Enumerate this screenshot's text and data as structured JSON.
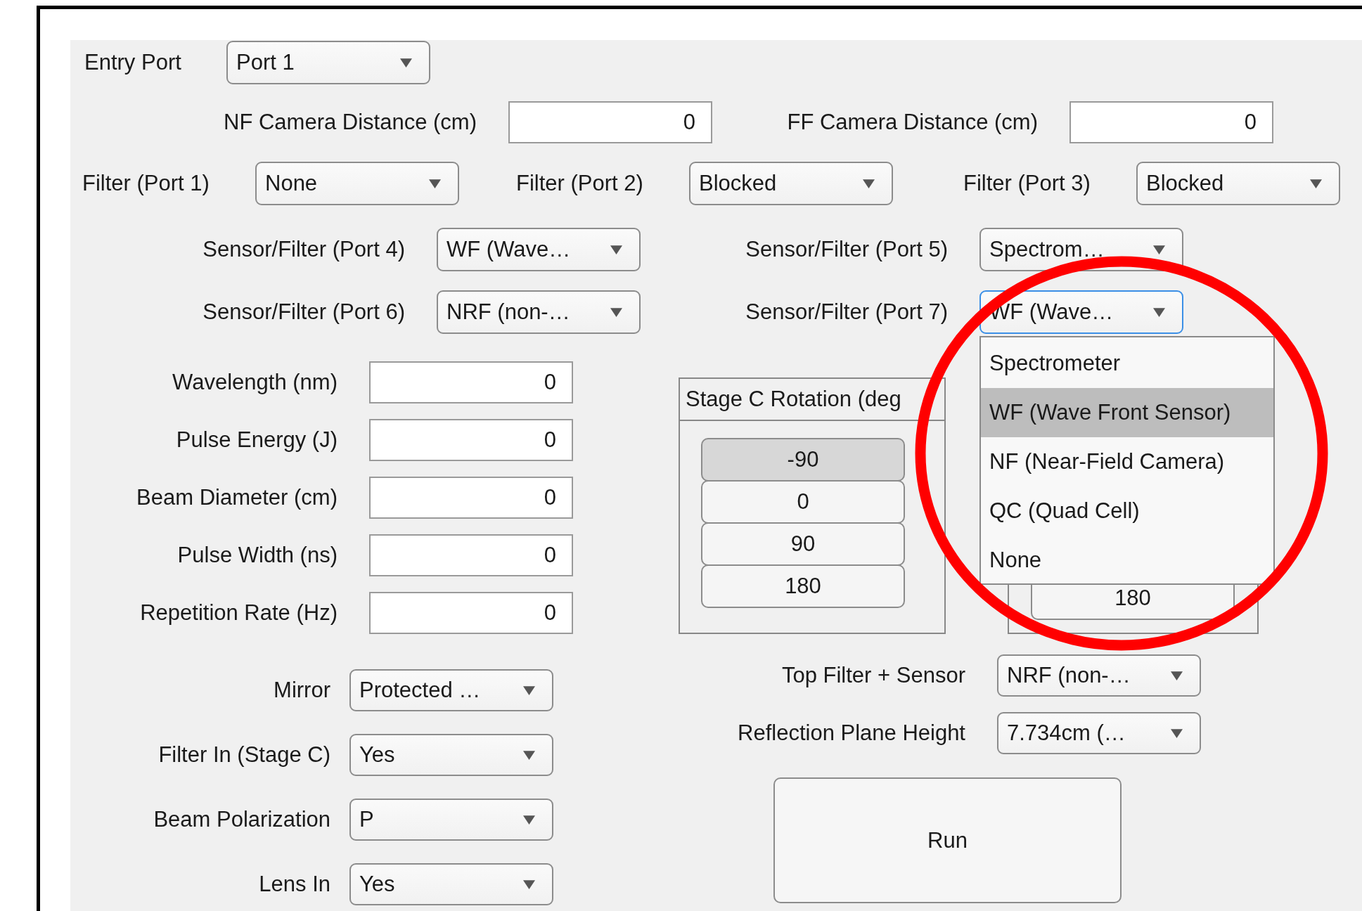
{
  "entry_port": {
    "label": "Entry Port",
    "value": "Port 1"
  },
  "camera_distances": [
    {
      "label": "NF Camera Distance (cm)",
      "value": "0"
    },
    {
      "label": "FF Camera Distance (cm)",
      "value": "0"
    }
  ],
  "filters": [
    {
      "label": "Filter (Port 1)",
      "value": "None"
    },
    {
      "label": "Filter (Port 2)",
      "value": "Blocked"
    },
    {
      "label": "Filter (Port 3)",
      "value": "Blocked"
    }
  ],
  "sensor_filters": [
    {
      "label": "Sensor/Filter (Port 4)",
      "value": "WF (Wave…",
      "focused": false
    },
    {
      "label": "Sensor/Filter (Port 5)",
      "value": "Spectrom…",
      "focused": false
    },
    {
      "label": "Sensor/Filter (Port 6)",
      "value": "NRF (non-…",
      "focused": false
    },
    {
      "label": "Sensor/Filter (Port 7)",
      "value": "WF (Wave…",
      "focused": true
    }
  ],
  "open_dropdown": {
    "options": [
      {
        "label": "Spectrometer",
        "selected": false
      },
      {
        "label": "WF (Wave Front Sensor)",
        "selected": true
      },
      {
        "label": "NF (Near-Field Camera)",
        "selected": false
      },
      {
        "label": "QC (Quad Cell)",
        "selected": false
      },
      {
        "label": "None",
        "selected": false
      }
    ]
  },
  "beam_fields": [
    {
      "label": "Wavelength (nm)",
      "value": "0"
    },
    {
      "label": "Pulse Energy (J)",
      "value": "0"
    },
    {
      "label": "Beam Diameter (cm)",
      "value": "0"
    },
    {
      "label": "Pulse Width (ns)",
      "value": "0"
    },
    {
      "label": "Repetition Rate (Hz)",
      "value": "0"
    }
  ],
  "optics": [
    {
      "label": "Mirror",
      "value": "Protected …"
    },
    {
      "label": "Filter In (Stage C)",
      "value": "Yes"
    },
    {
      "label": "Beam Polarization",
      "value": "P"
    },
    {
      "label": "Lens In",
      "value": "Yes"
    }
  ],
  "stage_c_rotation": {
    "title": "Stage C Rotation (deg",
    "buttons": [
      {
        "label": "-90",
        "selected": true
      },
      {
        "label": "0",
        "selected": false
      },
      {
        "label": "90",
        "selected": false
      },
      {
        "label": "180",
        "selected": false
      }
    ]
  },
  "second_rotation_panel": {
    "buttons": [
      {
        "label": "180",
        "selected": false
      }
    ]
  },
  "sensor_settings": [
    {
      "label": "Top Filter + Sensor",
      "value": "NRF (non-…"
    },
    {
      "label": "Reflection Plane Height",
      "value": "7.734cm (…"
    }
  ],
  "run_button": "Run",
  "annotation": {
    "kind": "ellipse"
  }
}
